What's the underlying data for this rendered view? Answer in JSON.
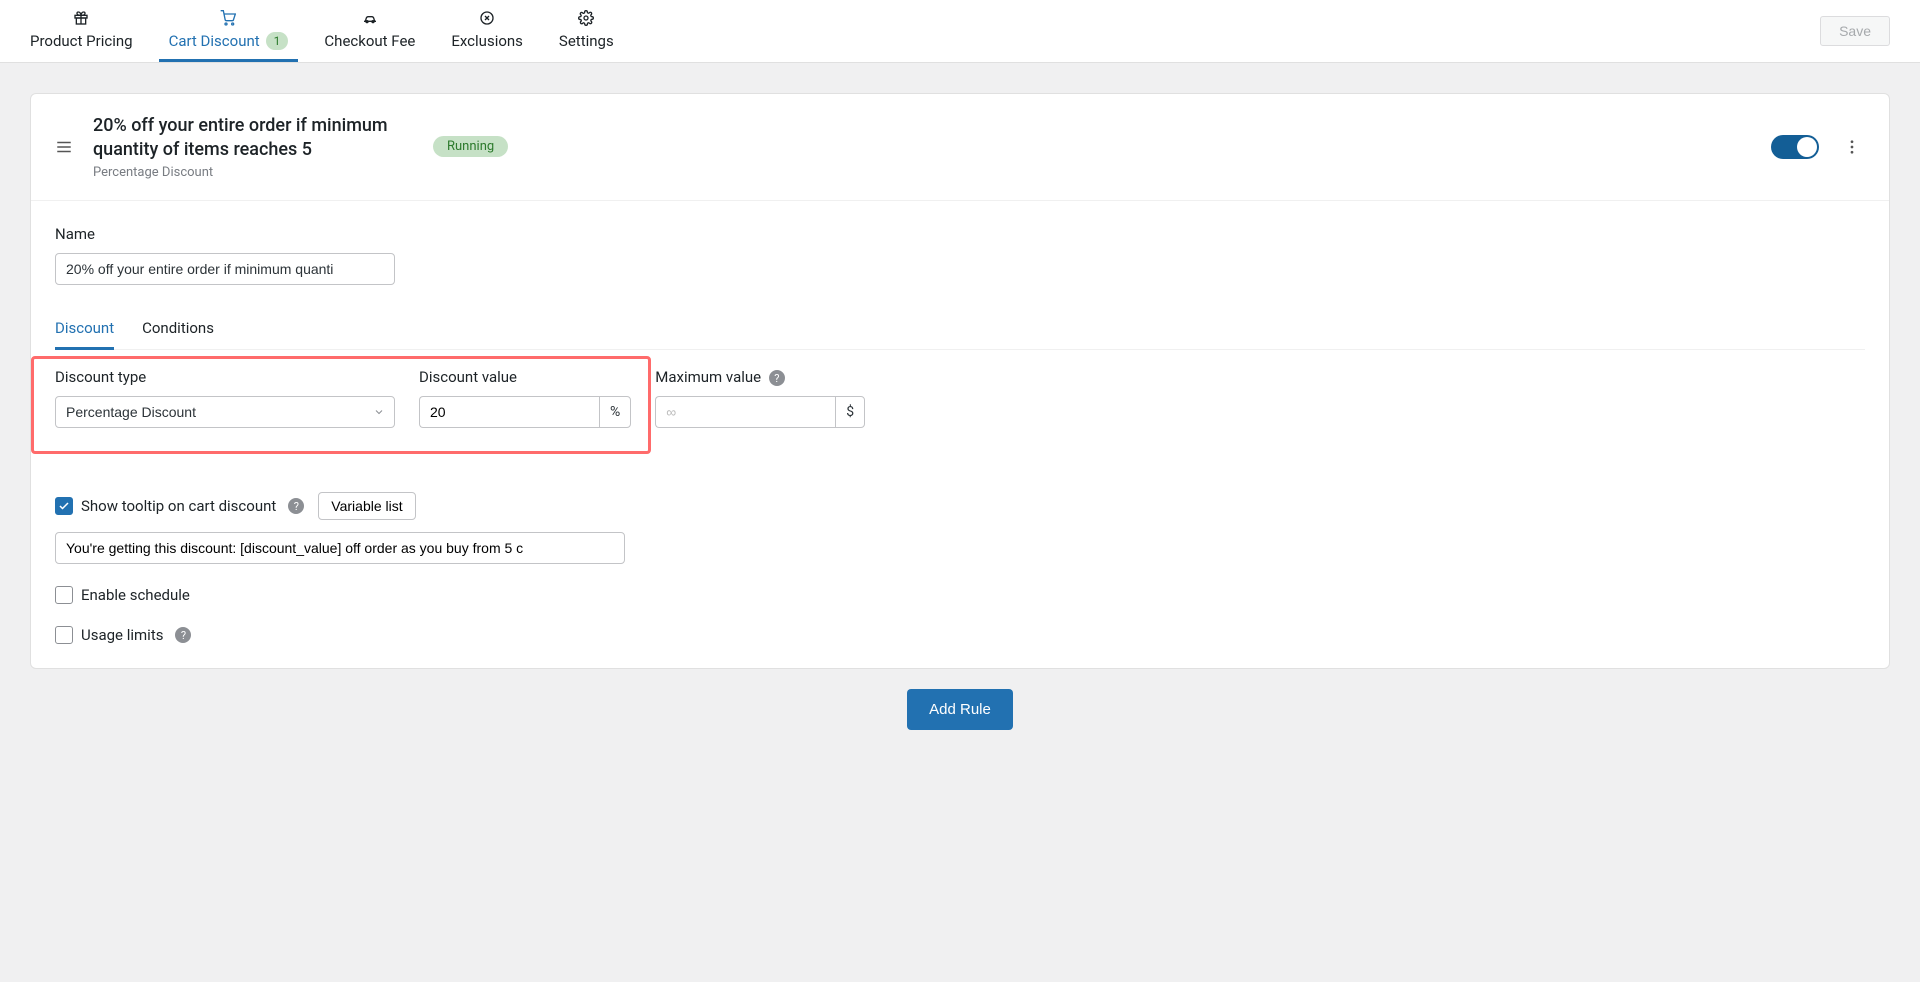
{
  "topbar": {
    "save_label": "Save",
    "tabs": [
      {
        "label": "Product Pricing"
      },
      {
        "label": "Cart Discount",
        "badge": "1"
      },
      {
        "label": "Checkout Fee"
      },
      {
        "label": "Exclusions"
      },
      {
        "label": "Settings"
      }
    ]
  },
  "rule": {
    "title": "20% off your entire order if minimum quantity of items reaches 5",
    "subtitle": "Percentage Discount",
    "status": "Running",
    "enabled": true
  },
  "form": {
    "name_label": "Name",
    "name_value": "20% off your entire order if minimum quanti",
    "subtabs": {
      "discount": "Discount",
      "conditions": "Conditions"
    },
    "discount_type_label": "Discount type",
    "discount_type_value": "Percentage Discount",
    "discount_value_label": "Discount value",
    "discount_value": "20",
    "discount_value_suffix": "%",
    "max_value_label": "Maximum value",
    "max_value_placeholder": "∞",
    "max_value_suffix": "$",
    "tooltip_label": "Show tooltip on cart discount",
    "variable_list_label": "Variable list",
    "tooltip_text": "You're getting this discount: [discount_value] off order as you buy from 5 c",
    "schedule_label": "Enable schedule",
    "usage_label": "Usage limits"
  },
  "add_rule_label": "Add Rule",
  "help_glyph": "?"
}
